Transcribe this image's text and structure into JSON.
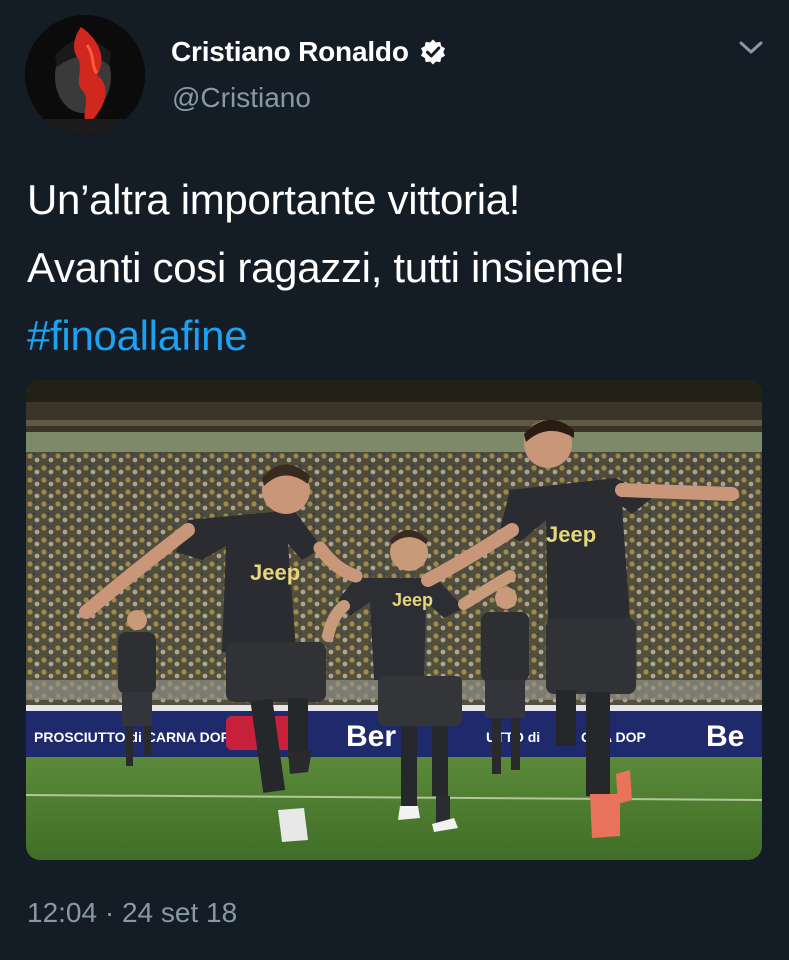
{
  "user": {
    "display_name": "Cristiano Ronaldo",
    "handle": "@Cristiano",
    "verified": true
  },
  "tweet": {
    "line1": "Un’altra importante vittoria!",
    "line2": "Avanti cosi ragazzi, tutti insieme!",
    "hashtag": "#finoallafine",
    "timestamp": "12:04 · 24 set 18"
  },
  "media": {
    "jersey_sponsor": "Jeep",
    "ad_board_texts": [
      "PROSCIUTTO di CAR",
      "NA DOP",
      "Ber",
      "UTTO di",
      "GNA DOP",
      "Be"
    ]
  },
  "colors": {
    "background": "#141d26",
    "text_primary": "#ffffff",
    "text_secondary": "#8899a6",
    "link": "#1da1f2"
  },
  "icons": {
    "verified": "verified-badge-icon",
    "caret": "chevron-down-icon"
  }
}
